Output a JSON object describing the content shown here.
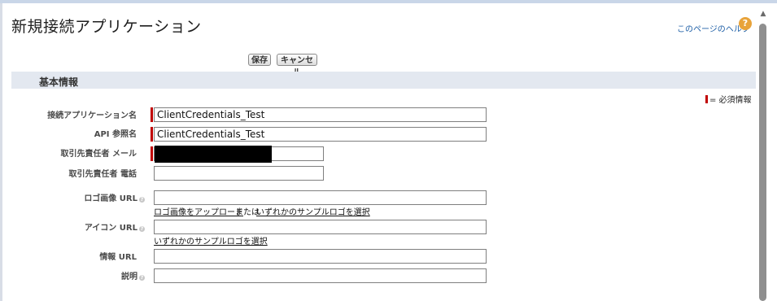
{
  "page": {
    "title": "新規接続アプリケーション",
    "help_link": "このページのヘルプ",
    "help_icon": "?"
  },
  "toolbar": {
    "save_label": "保存",
    "cancel_label": "キャンセル"
  },
  "section": {
    "title": "基本情報",
    "required_legend": "= 必須情報"
  },
  "fields": {
    "app_name": {
      "label": "接続アプリケーション名",
      "value": "ClientCredentials_Test",
      "required": true
    },
    "api_name": {
      "label": "API 参照名",
      "value": "ClientCredentials_Test",
      "required": true
    },
    "contact_email": {
      "label": "取引先責任者 メール",
      "value": "",
      "required": true,
      "redacted": true
    },
    "contact_phone": {
      "label": "取引先責任者 電話",
      "value": ""
    },
    "logo_url": {
      "label": "ロゴ画像 URL",
      "value": "",
      "upload_link": "ロゴ画像をアップロード",
      "or_text": "または",
      "sample_link": "いずれかのサンプルロゴを選択"
    },
    "icon_url": {
      "label": "アイコン URL",
      "value": "",
      "sample_link": "いずれかのサンプルロゴを選択"
    },
    "info_url": {
      "label": "情報 URL",
      "value": ""
    },
    "description": {
      "label": "説明",
      "value": ""
    }
  },
  "colors": {
    "required_marker": "#c00000",
    "section_bg": "#e3e8f0",
    "help_icon_bg": "#e8a33a"
  },
  "icons": {
    "help": "help-icon",
    "info": "info-icon",
    "scroll_up": "chevron-up-icon"
  }
}
